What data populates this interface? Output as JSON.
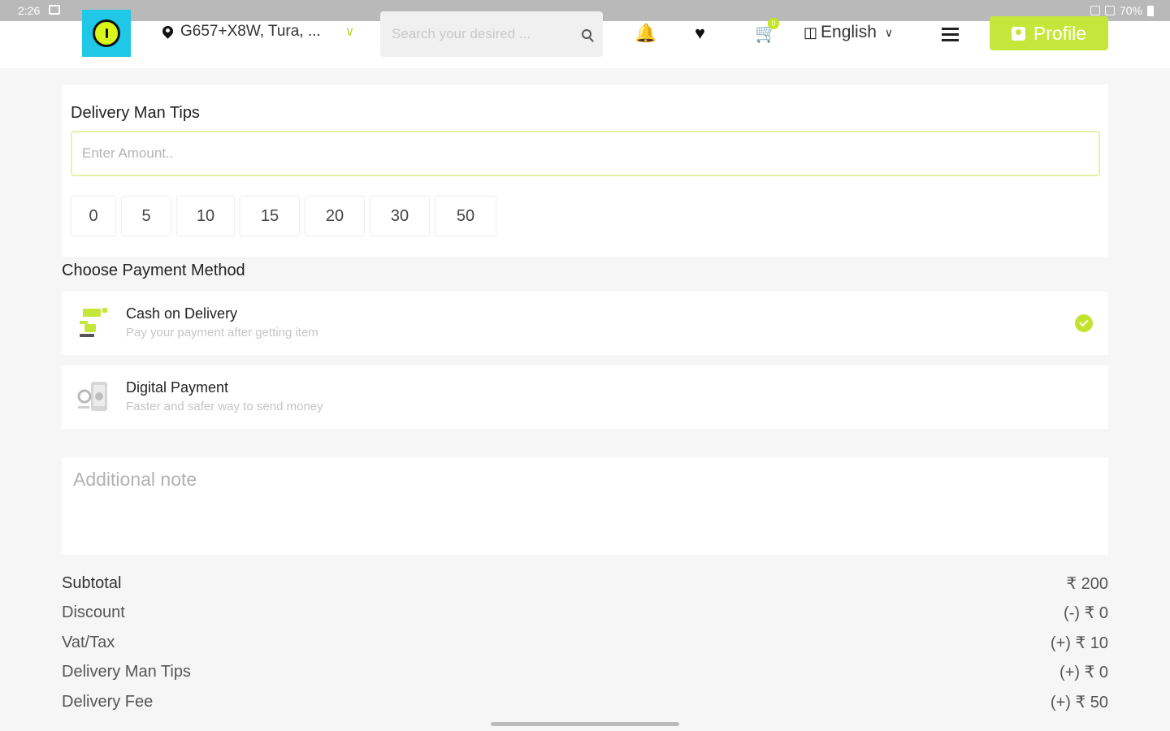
{
  "status_bar": {
    "time": "2:26",
    "battery": "70%"
  },
  "header": {
    "location": "G657+X8W, Tura, ...",
    "search_placeholder": "Search your desired ...",
    "cart_count": "0",
    "language": "English",
    "profile_label": "Profile"
  },
  "tips": {
    "title": "Delivery Man Tips",
    "placeholder": "Enter Amount..",
    "options": [
      "0",
      "5",
      "10",
      "15",
      "20",
      "30",
      "50"
    ]
  },
  "payment": {
    "title": "Choose Payment Method",
    "methods": [
      {
        "title": "Cash on Delivery",
        "subtitle": "Pay your payment after getting item",
        "selected": true
      },
      {
        "title": "Digital Payment",
        "subtitle": "Faster and safer way to send money",
        "selected": false
      }
    ]
  },
  "note": {
    "placeholder": "Additional note"
  },
  "summary": [
    {
      "label": "Subtotal",
      "value": "₹ 200"
    },
    {
      "label": "Discount",
      "value": "(-) ₹ 0"
    },
    {
      "label": "Vat/Tax",
      "value": "(+) ₹ 10"
    },
    {
      "label": "Delivery Man Tips",
      "value": "(+) ₹ 0"
    },
    {
      "label": "Delivery Fee",
      "value": "(+) ₹ 50"
    }
  ],
  "colors": {
    "accent": "#c5e63a",
    "logo_bg": "#1ec8e6"
  },
  "icons": [
    "location-pin-icon",
    "chevron-down-icon",
    "search-icon",
    "bell-icon",
    "heart-icon",
    "cart-icon",
    "translate-icon",
    "hamburger-menu-icon",
    "profile-icon",
    "cash-icon",
    "digital-payment-icon",
    "check-icon"
  ]
}
